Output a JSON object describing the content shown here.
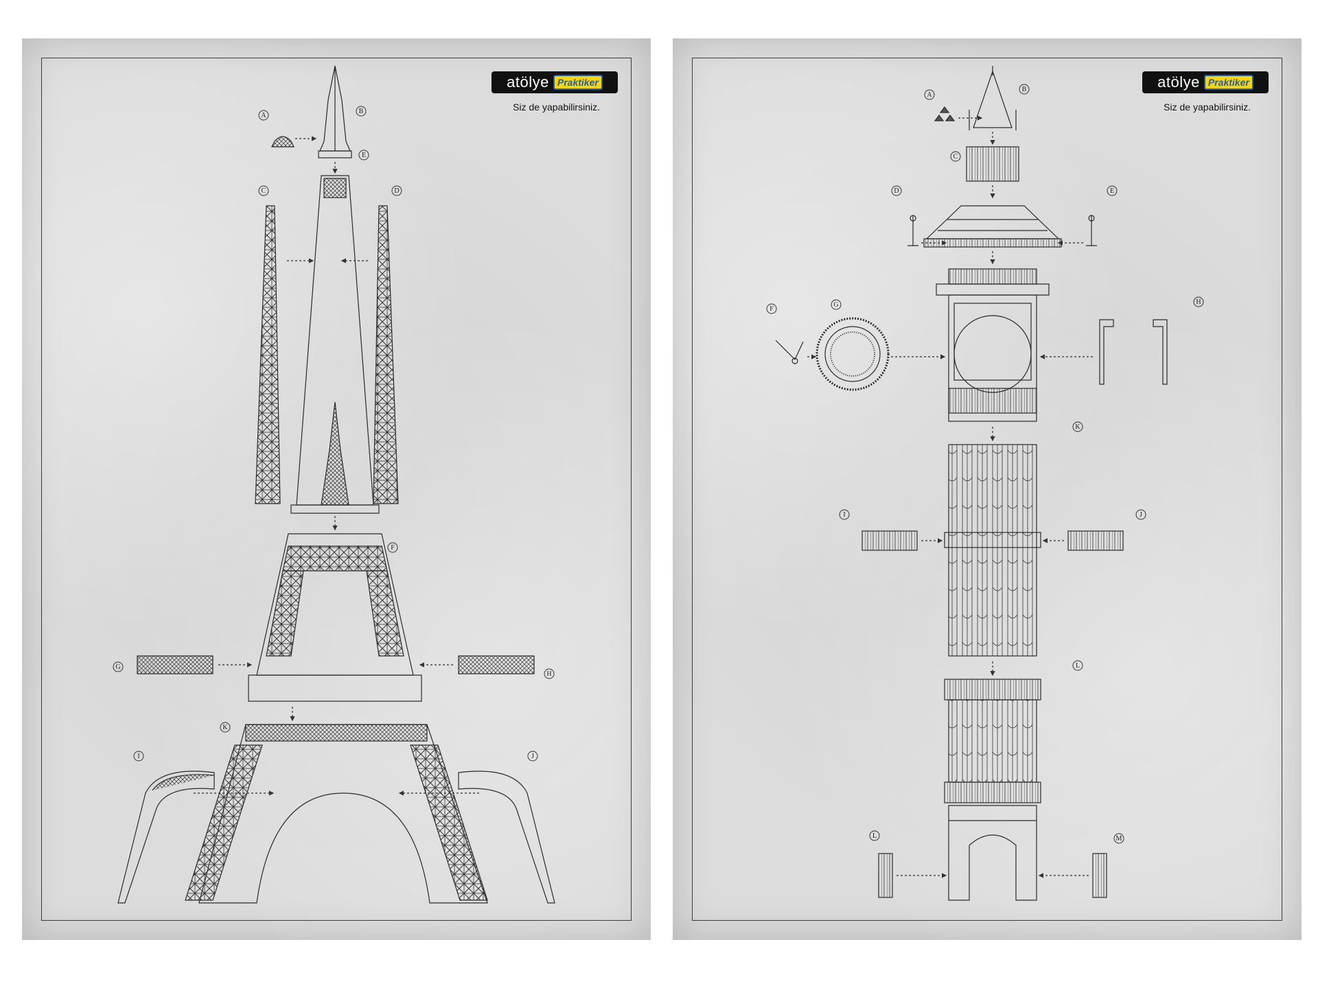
{
  "brand": {
    "word": "atölye",
    "badge": "Praktiker"
  },
  "tagline": "Siz de yapabilirsiniz.",
  "eiffel_labels": [
    "A",
    "B",
    "C",
    "D",
    "E",
    "F",
    "G",
    "H",
    "I",
    "J",
    "K"
  ],
  "bigben_labels": [
    "A",
    "B",
    "C",
    "D",
    "E",
    "F",
    "G",
    "H",
    "I",
    "J",
    "K",
    "L",
    "L",
    "M"
  ],
  "colors": {
    "paper": "#dcdcdc",
    "ink": "#2a2a2a",
    "logo_bg": "#111111",
    "logo_badge": "#ffd400",
    "logo_badge_text": "#1a5fb4"
  }
}
